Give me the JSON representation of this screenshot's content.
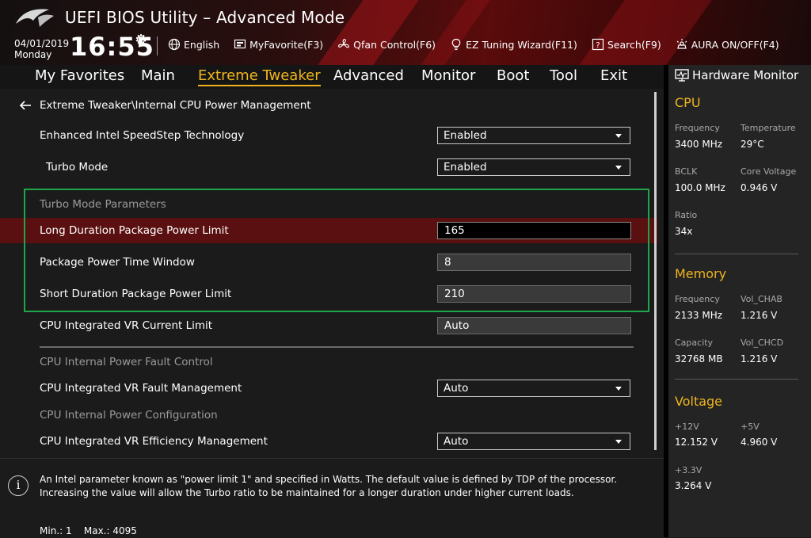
{
  "app": {
    "title": "UEFI BIOS Utility – Advanced Mode",
    "date": "04/01/2019",
    "day": "Monday",
    "time": "16:55"
  },
  "toolbar": [
    {
      "label": "English",
      "icon": "globe-icon"
    },
    {
      "label": "MyFavorite(F3)",
      "icon": "favorite-icon"
    },
    {
      "label": "Qfan Control(F6)",
      "icon": "fan-icon"
    },
    {
      "label": "EZ Tuning Wizard(F11)",
      "icon": "lightbulb-icon"
    },
    {
      "label": "Search(F9)",
      "icon": "search-icon"
    },
    {
      "label": "AURA ON/OFF(F4)",
      "icon": "aura-icon"
    }
  ],
  "tabs": [
    {
      "label": "My Favorites"
    },
    {
      "label": "Main"
    },
    {
      "label": "Extreme Tweaker",
      "active": true
    },
    {
      "label": "Advanced"
    },
    {
      "label": "Monitor"
    },
    {
      "label": "Boot"
    },
    {
      "label": "Tool"
    },
    {
      "label": "Exit"
    }
  ],
  "breadcrumb": "Extreme Tweaker\\Internal CPU Power Management",
  "settings": {
    "speedstep": {
      "label": "Enhanced Intel SpeedStep Technology",
      "value": "Enabled"
    },
    "turbo_mode": {
      "label": "Turbo Mode",
      "value": "Enabled"
    },
    "turbo_params_header": "Turbo Mode Parameters",
    "long_duration": {
      "label": "Long Duration Package Power Limit",
      "value": "165"
    },
    "time_window": {
      "label": "Package Power Time Window",
      "value": "8"
    },
    "short_duration": {
      "label": "Short Duration Package Power Limit",
      "value": "210"
    },
    "vr_current_limit": {
      "label": "CPU Integrated VR Current Limit",
      "value": "Auto"
    },
    "fault_control_header": "CPU Internal Power Fault Control",
    "vr_fault_mgmt": {
      "label": "CPU Integrated VR Fault Management",
      "value": "Auto"
    },
    "power_config_header": "CPU Internal Power Configuration",
    "vr_efficiency_mgmt": {
      "label": "CPU Integrated VR Efficiency Management",
      "value": "Auto"
    }
  },
  "info": {
    "text": "An Intel parameter known as \"power limit 1\" and specified in Watts. The default value is defined by TDP of the processor. Increasing the value will allow the Turbo ratio to be maintained for a longer duration under higher current loads.",
    "min": "Min.: 1",
    "max": "Max.: 4095"
  },
  "hardware_monitor": {
    "title": "Hardware Monitor",
    "cpu": {
      "header": "CPU",
      "frequency": {
        "label": "Frequency",
        "value": "3400 MHz"
      },
      "temperature": {
        "label": "Temperature",
        "value": "29°C"
      },
      "bclk": {
        "label": "BCLK",
        "value": "100.0 MHz"
      },
      "core_voltage": {
        "label": "Core Voltage",
        "value": "0.946 V"
      },
      "ratio": {
        "label": "Ratio",
        "value": "34x"
      }
    },
    "memory": {
      "header": "Memory",
      "frequency": {
        "label": "Frequency",
        "value": "2133 MHz"
      },
      "vol_chab": {
        "label": "Vol_CHAB",
        "value": "1.216 V"
      },
      "capacity": {
        "label": "Capacity",
        "value": "32768 MB"
      },
      "vol_chcd": {
        "label": "Vol_CHCD",
        "value": "1.216 V"
      }
    },
    "voltage": {
      "header": "Voltage",
      "v12": {
        "label": "+12V",
        "value": "12.152 V"
      },
      "v5": {
        "label": "+5V",
        "value": "4.960 V"
      },
      "v33": {
        "label": "+3.3V",
        "value": "3.264 V"
      }
    }
  },
  "colors": {
    "accent": "#f0b41e",
    "highlight_row": "#5a1010",
    "annotation_box": "#1fa64a"
  }
}
